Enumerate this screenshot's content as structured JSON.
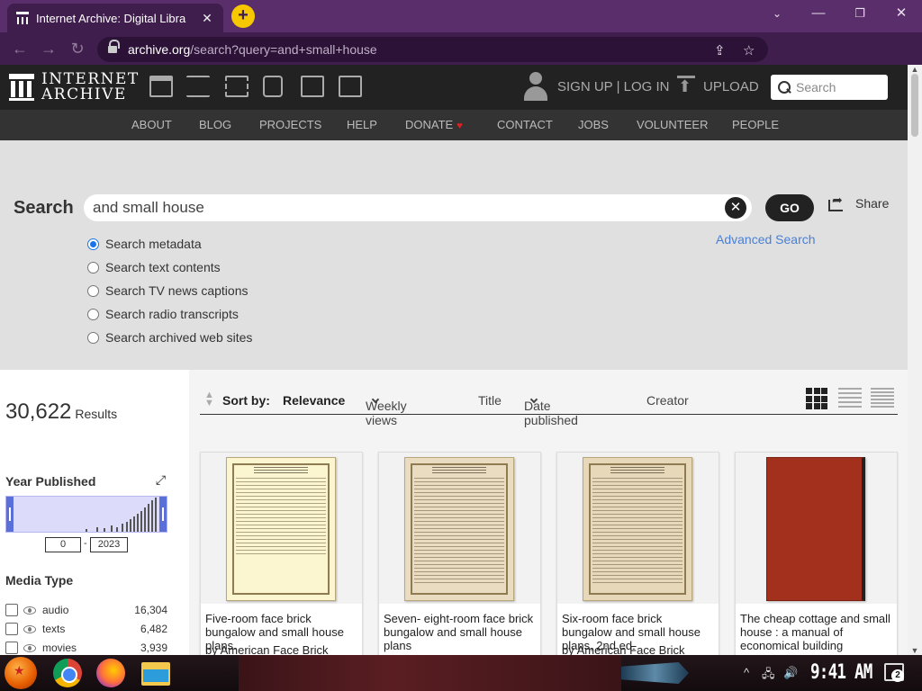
{
  "browser": {
    "tab_title": "Internet Archive: Digital Libra",
    "tab_close": "✕",
    "new_tab": "+",
    "url_host": "archive.org",
    "url_path": "/search?query=and+small+house",
    "window_controls": [
      "minimize-icon",
      "restore-icon",
      "close-icon"
    ]
  },
  "header": {
    "logo_line1": "INTERNET",
    "logo_line2": "ARCHIVE",
    "media_icons": [
      "web-icon",
      "texts-icon",
      "video-icon",
      "audio-icon",
      "software-icon",
      "images-icon"
    ],
    "signup_label": "SIGN UP | LOG IN",
    "upload_label": "UPLOAD",
    "search_placeholder": "Search"
  },
  "nav": {
    "items": [
      "ABOUT",
      "BLOG",
      "PROJECTS",
      "HELP",
      "DONATE",
      "CONTACT",
      "JOBS",
      "VOLUNTEER",
      "PEOPLE"
    ]
  },
  "search": {
    "label": "Search",
    "query": "and small house",
    "go_label": "GO",
    "share_label": "Share",
    "advanced_label": "Advanced Search",
    "options": [
      {
        "label": "Search metadata",
        "selected": true
      },
      {
        "label": "Search text contents",
        "selected": false
      },
      {
        "label": "Search TV news captions",
        "selected": false
      },
      {
        "label": "Search radio transcripts",
        "selected": false
      },
      {
        "label": "Search archived web sites",
        "selected": false
      }
    ]
  },
  "results": {
    "count": "30,622",
    "count_label": "Results"
  },
  "facets": {
    "year_title": "Year Published",
    "year_from": "0",
    "year_to": "2023",
    "media_title": "Media Type",
    "media": [
      {
        "name": "audio",
        "count": "16,304"
      },
      {
        "name": "texts",
        "count": "6,482"
      },
      {
        "name": "movies",
        "count": "3,939"
      }
    ]
  },
  "sort": {
    "label": "Sort by:",
    "options": [
      "Relevance",
      "Weekly views",
      "Title",
      "Date published",
      "Creator"
    ],
    "active": "Relevance"
  },
  "cards": [
    {
      "title": "Five-room face brick bungalow and small house plans.",
      "by": "by American Face Brick"
    },
    {
      "title": "Seven- eight-room face brick bungalow and small house plans",
      "by": ""
    },
    {
      "title": "Six-room face brick bungalow and small house plans, 2nd ed.",
      "by": "by American Face Brick"
    },
    {
      "title": "The cheap cottage and small house : a manual of economical building",
      "by": ""
    }
  ],
  "taskbar": {
    "clock": "9:41 AM",
    "notification_count": "2",
    "apps": [
      "start-icon",
      "chrome-icon",
      "firefox-icon",
      "file-explorer-icon"
    ]
  }
}
